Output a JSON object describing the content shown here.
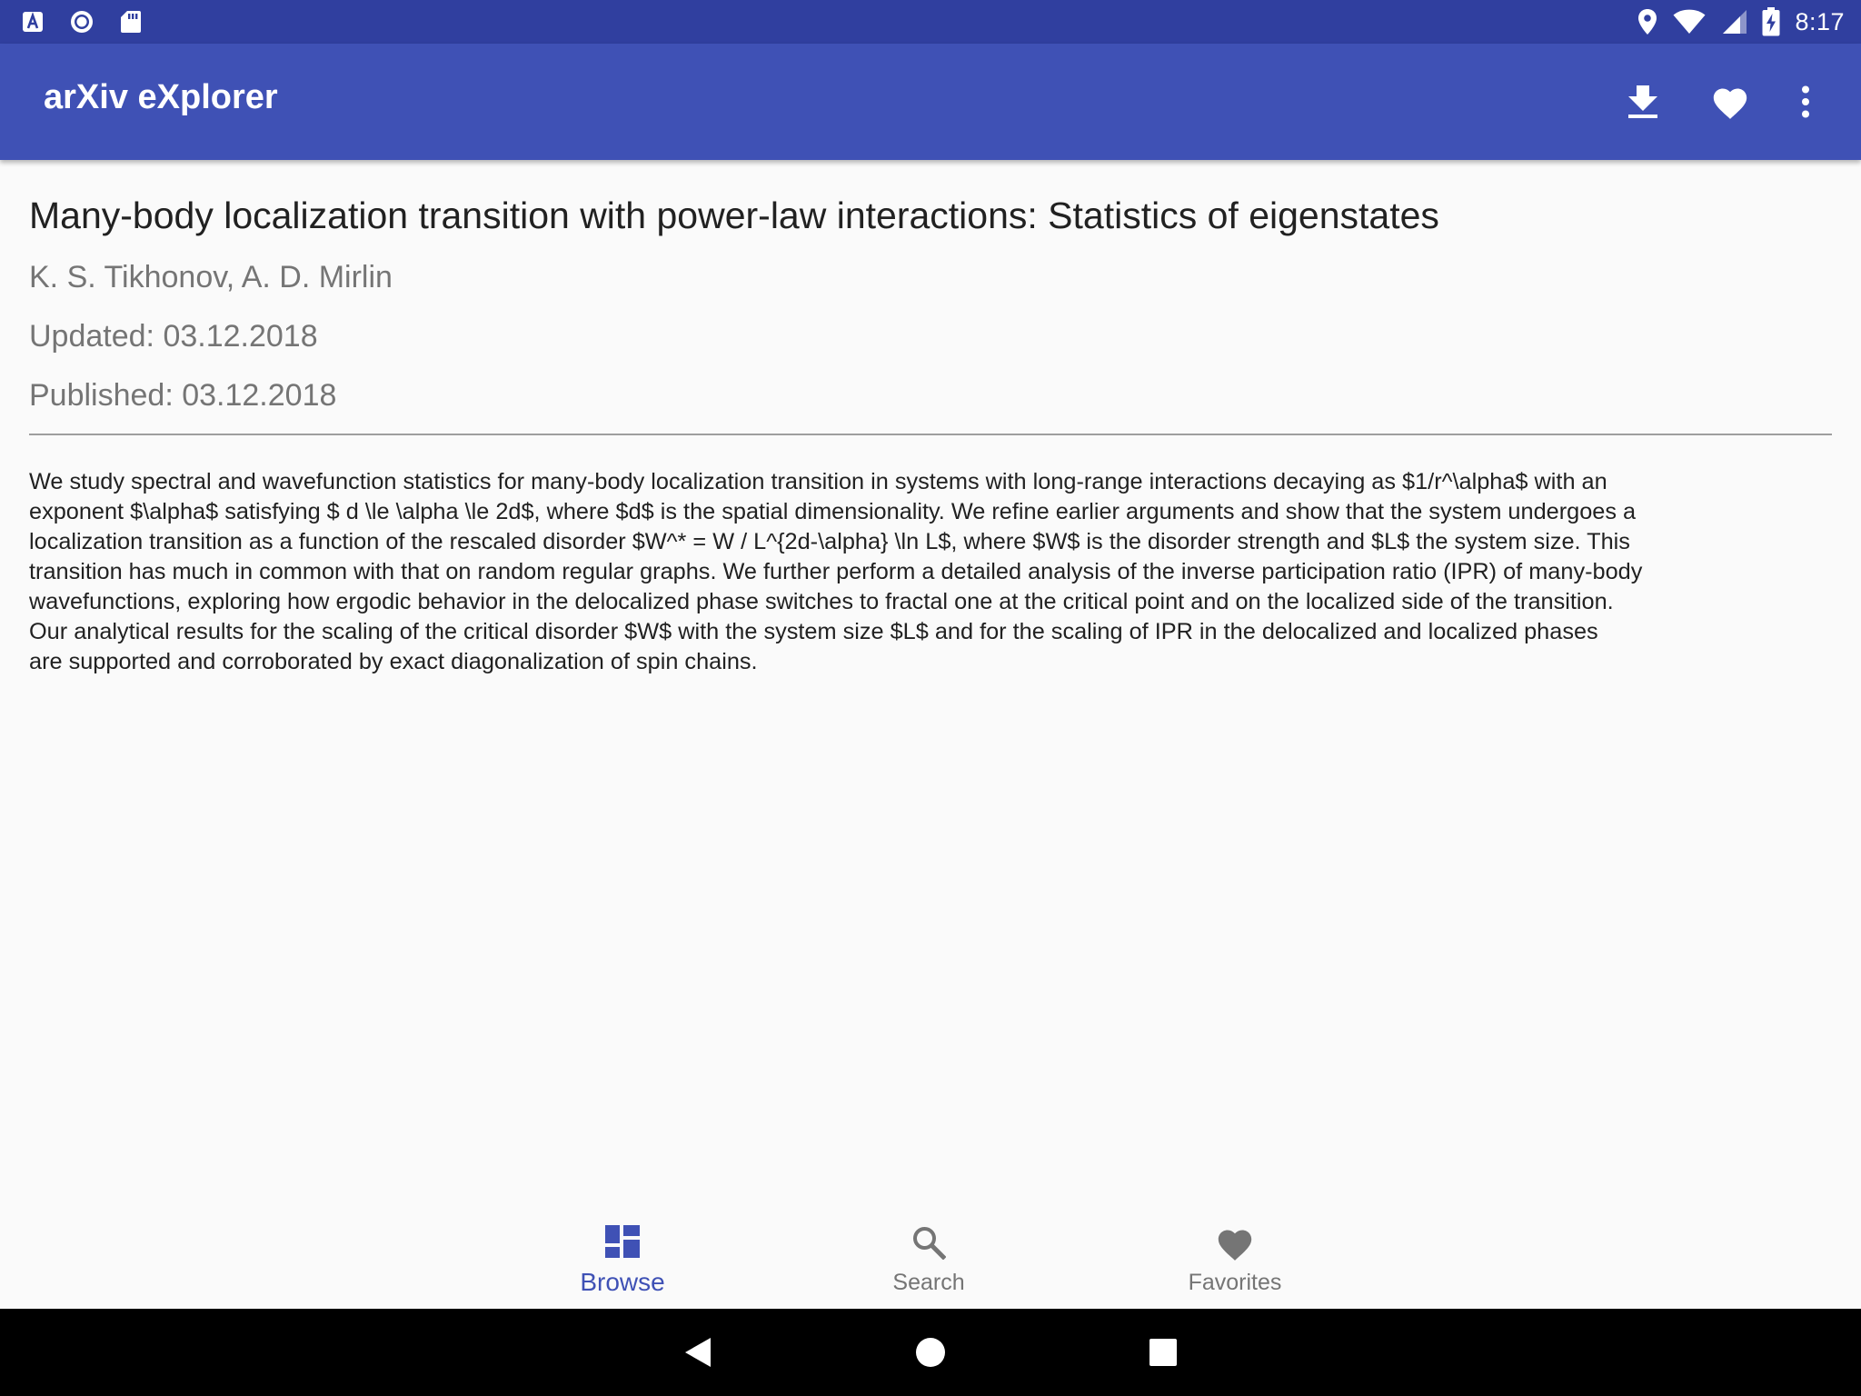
{
  "status_bar": {
    "time": "8:17",
    "left_icons": [
      "text-a-icon",
      "record-circle-icon",
      "sd-card-icon"
    ],
    "right_icons": [
      "location-icon",
      "wifi-icon",
      "signal-icon",
      "battery-charging-icon"
    ]
  },
  "app_bar": {
    "title": "arXiv eXplorer",
    "actions": [
      "download-icon",
      "heart-icon",
      "more-vert-icon"
    ]
  },
  "paper": {
    "title": "Many-body localization transition with power-law interactions: Statistics of eigenstates",
    "authors": "K. S. Tikhonov, A. D. Mirlin",
    "updated": "Updated: 03.12.2018",
    "published": "Published: 03.12.2018",
    "abstract_lines": [
      "We study spectral and wavefunction statistics for many-body localization transition in systems with long-range interactions decaying as $1/r^\\alpha$ with an",
      "exponent $\\alpha$ satisfying $ d \\le \\alpha \\le 2d$, where $d$ is the spatial dimensionality. We refine earlier arguments and show that the system undergoes a",
      "localization transition as a function of the rescaled disorder $W^* = W / L^{2d-\\alpha} \\ln L$, where $W$ is the disorder strength and $L$ the system size. This",
      "transition has much in common with that on random regular graphs. We further perform a detailed analysis of the inverse participation ratio (IPR) of many-body",
      "wavefunctions, exploring how ergodic behavior in the delocalized phase switches to fractal one at the critical point and on the localized side of the transition.",
      "Our analytical results for the scaling of the critical disorder $W$ with the system size $L$ and for the scaling of IPR in the delocalized and localized phases",
      "are supported and corroborated by exact diagonalization of spin chains."
    ]
  },
  "bottom_nav": {
    "items": [
      {
        "label": "Browse",
        "icon": "dashboard-icon",
        "active": true
      },
      {
        "label": "Search",
        "icon": "search-icon",
        "active": false
      },
      {
        "label": "Favorites",
        "icon": "heart-icon",
        "active": false
      }
    ]
  },
  "system_nav": {
    "buttons": [
      "back-icon",
      "home-icon",
      "recents-icon"
    ]
  },
  "colors": {
    "status_bar": "#303f9f",
    "primary": "#3f51b5",
    "background": "#fafafa",
    "text_primary": "#212121",
    "text_secondary": "#757575"
  }
}
